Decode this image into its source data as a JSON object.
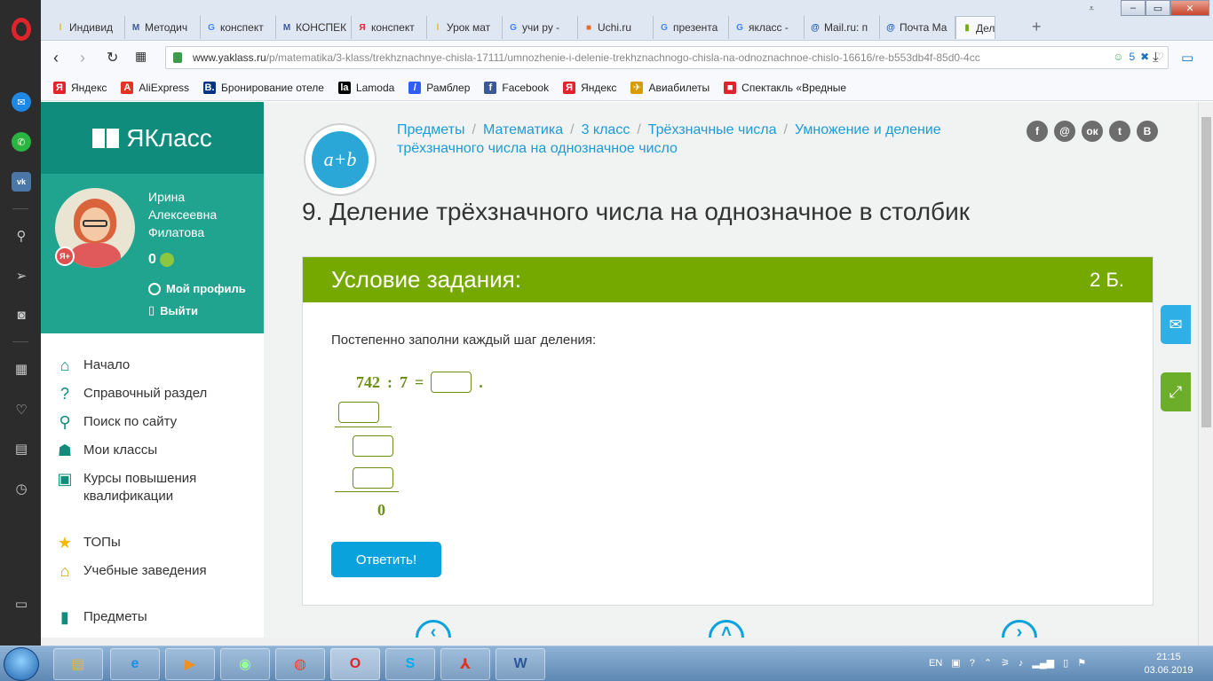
{
  "browser": {
    "tabs": [
      {
        "label": "Индивид",
        "fav": "ǀ",
        "favColor": "#e2b400"
      },
      {
        "label": "Методич",
        "fav": "М",
        "favColor": "#3b5998"
      },
      {
        "label": "конспект",
        "fav": "G",
        "favColor": "#4285f4"
      },
      {
        "label": "КОНСПЕК",
        "fav": "М",
        "favColor": "#3b5998"
      },
      {
        "label": "конспект",
        "fav": "Я",
        "favColor": "#e0242b"
      },
      {
        "label": "Урок мат",
        "fav": "ǀ",
        "favColor": "#e2b400"
      },
      {
        "label": "учи ру -",
        "fav": "G",
        "favColor": "#4285f4"
      },
      {
        "label": "Uchi.ru",
        "fav": "■",
        "favColor": "#e96b2a"
      },
      {
        "label": "презента",
        "fav": "G",
        "favColor": "#4285f4"
      },
      {
        "label": "якласс -",
        "fav": "G",
        "favColor": "#4285f4"
      },
      {
        "label": "Mail.ru: п",
        "fav": "@",
        "favColor": "#1a5bb5"
      },
      {
        "label": "Почта Ма",
        "fav": "@",
        "favColor": "#1a5bb5"
      },
      {
        "label": "Деле",
        "fav": "▮",
        "favColor": "#76a900"
      }
    ],
    "url_host": "www.yaklass.ru",
    "url_path": "/p/matematika/3-klass/trekhznachnye-chisla-17111/umnozhenie-i-delenie-trekhznachnogo-chisla-na-odnoznachnoe-chislo-16616/re-b553db4f-85d0-4cc",
    "url_badge": "5",
    "bookmarks": [
      {
        "label": "Яндекс",
        "fav": "Я",
        "color": "#e0242b"
      },
      {
        "label": "AliExpress",
        "fav": "A",
        "color": "#e43225"
      },
      {
        "label": "Бронирование отеле",
        "fav": "B.",
        "color": "#003580"
      },
      {
        "label": "Lamoda",
        "fav": "la",
        "color": "#000000"
      },
      {
        "label": "Рамблер",
        "fav": "/",
        "color": "#315efb"
      },
      {
        "label": "Facebook",
        "fav": "f",
        "color": "#3b5998"
      },
      {
        "label": "Яндекс",
        "fav": "Я",
        "color": "#e0242b"
      },
      {
        "label": "Авиабилеты",
        "fav": "✈",
        "color": "#d89b00"
      },
      {
        "label": "Спектакль «Вредные",
        "fav": "■",
        "color": "#e0242b"
      }
    ]
  },
  "site": {
    "brand": "ЯКласс",
    "user": {
      "name": "Ирина Алексеевна Филатова",
      "points": "0",
      "badge": "Я+",
      "profile_link": "Мой профиль",
      "logout_link": "Выйти"
    },
    "menu": [
      {
        "label": "Начало",
        "icon": "home-icon",
        "glyph": "⌂"
      },
      {
        "label": "Справочный раздел",
        "icon": "help-icon",
        "glyph": "?"
      },
      {
        "label": "Поиск по сайту",
        "icon": "search-icon",
        "glyph": "⚲"
      },
      {
        "label": "Мои классы",
        "icon": "classes-icon",
        "glyph": "☗"
      },
      {
        "label": "Курсы повышения квалификации",
        "icon": "certificate-icon",
        "glyph": "▣"
      },
      {
        "label": "ТОПы",
        "icon": "star-icon",
        "glyph": "★"
      },
      {
        "label": "Учебные заведения",
        "icon": "institution-icon",
        "glyph": "⌂"
      },
      {
        "label": "Предметы",
        "icon": "subjects-icon",
        "glyph": "▮"
      }
    ],
    "lesson_icon": "a+b",
    "breadcrumbs": [
      "Предметы",
      "Математика",
      "3 класс",
      "Трёхзначные числа",
      "Умножение и деление трёхзначного числа на однозначное число"
    ],
    "social": [
      "f",
      "@",
      "ок",
      "t",
      "B"
    ],
    "title": "9. Деление трёхзначного числа на однозначное в столбик",
    "task": {
      "header": "Условие задания:",
      "points": "2 Б.",
      "instruction": "Постепенно заполни каждый шаг деления:",
      "dividend": "742",
      "op": ":",
      "divisor": "7",
      "eq": "=",
      "dot": ".",
      "remainder": "0",
      "submit_label": "Ответить!"
    }
  },
  "taskbar": {
    "lang": "EN",
    "time": "21:15",
    "date": "03.06.2019"
  }
}
